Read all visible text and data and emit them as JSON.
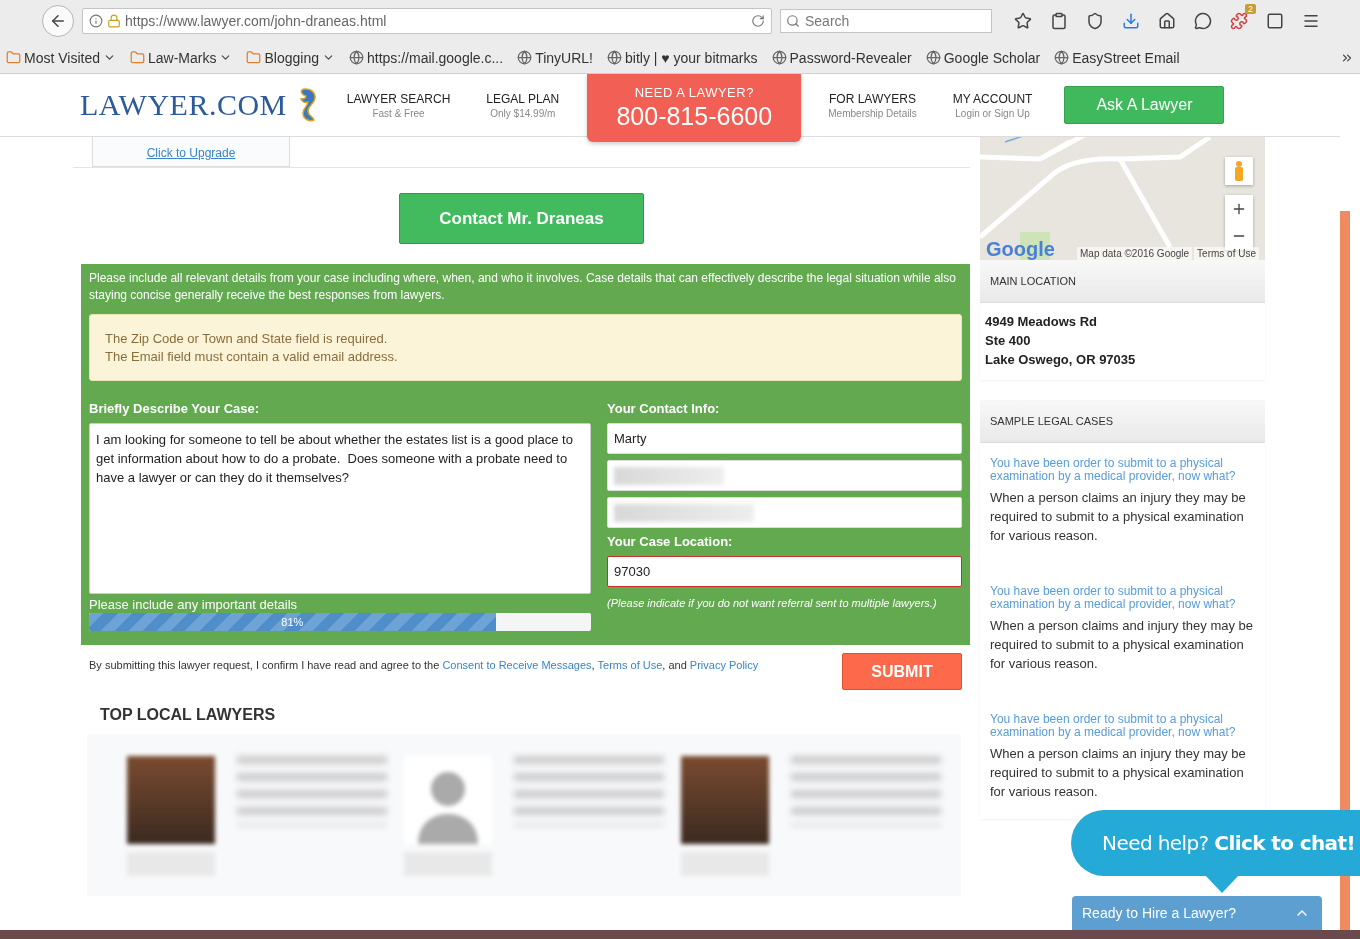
{
  "browser": {
    "url": "https://www.lawyer.com/john-draneas.html",
    "search_placeholder": "Search",
    "extension_badge": "2"
  },
  "bookmarks": [
    {
      "label": "Most Visited",
      "kind": "menu"
    },
    {
      "label": "Law-Marks",
      "kind": "menu"
    },
    {
      "label": "Blogging",
      "kind": "menu"
    },
    {
      "label": "https://mail.google.c...",
      "kind": "site"
    },
    {
      "label": "TinyURL!",
      "kind": "site"
    },
    {
      "label": "bitly | ♥ your bitmarks",
      "kind": "site"
    },
    {
      "label": "Password-Revealer",
      "kind": "site"
    },
    {
      "label": "Google Scholar",
      "kind": "site"
    },
    {
      "label": "EasyStreet Email",
      "kind": "site"
    }
  ],
  "site_header": {
    "logo": "LAWYER.COM",
    "nav": [
      {
        "title": "LAWYER SEARCH",
        "subtitle": "Fast & Free"
      },
      {
        "title": "LEGAL PLAN",
        "subtitle": "Only $14.99/m"
      }
    ],
    "call": {
      "title": "NEED A LAWYER?",
      "phone": "800-815-6600"
    },
    "nav_right": [
      {
        "title": "FOR LAWYERS",
        "subtitle": "Membership Details"
      },
      {
        "title": "MY ACCOUNT",
        "subtitle": "Login or Sign Up"
      }
    ],
    "cta": "Ask A Lawyer"
  },
  "profile": {
    "upgrade_link": "Click to Upgrade"
  },
  "contact_button": "Contact Mr. Draneas",
  "form": {
    "intro": "Please include all relevant details from your case including where, when, and who it involves. Case details that can effectively describe the legal situation while also staying concise generally receive the best responses from lawyers.",
    "errors": [
      "The Zip Code or Town and State field is required.",
      "The Email field must contain a valid email address."
    ],
    "case_label": "Briefly Describe Your Case:",
    "case_value": "I am looking for someone to tell be about whether the estates list is a good place to get information about how to do a probate.  Does someone with a probate need to have a lawyer or can they do it themselves?",
    "hint": "Please include any important details",
    "progress": {
      "level": 0.81,
      "label": "81%"
    },
    "contact_label": "Your Contact Info:",
    "contact_fields": [
      {
        "value": "Marty",
        "blurred": false
      },
      {
        "blurred": true
      },
      {
        "blurred": true
      }
    ],
    "location_label": "Your Case Location:",
    "location": {
      "value": "97030",
      "invalid": true
    },
    "location_note": "(Please indicate if you do not want referral sent to multiple lawyers.)"
  },
  "consent": [
    {
      "kind": "text",
      "text": "By submitting this lawyer request, I confirm I have read and agree to the "
    },
    {
      "kind": "link",
      "text": "Consent to Receive Messages"
    },
    {
      "kind": "text",
      "text": ", "
    },
    {
      "kind": "link",
      "text": "Terms of Use"
    },
    {
      "kind": "text",
      "text": ", and "
    },
    {
      "kind": "link",
      "text": "Privacy Policy"
    }
  ],
  "submit": "SUBMIT",
  "top_lawyers": {
    "title": "TOP LOCAL LAWYERS",
    "lawyers": [
      {
        "kind": "photo"
      },
      {
        "kind": "silhouette"
      },
      {
        "kind": "photo"
      }
    ]
  },
  "map": {
    "logo": "Google",
    "attribution": "Map data ©2016 Google",
    "terms": "Terms of Use"
  },
  "main_location": {
    "title": "MAIN LOCATION",
    "lines": [
      "4949 Meadows Rd",
      "Ste 400",
      "Lake Oswego, OR 97035"
    ]
  },
  "sample_cases": {
    "title": "SAMPLE LEGAL CASES",
    "cases": [
      {
        "title": "You have been order to submit to a physical examination by a medical provider, now what?",
        "body": "When a person claims an injury they may be required to submit to a physical examination for various reason."
      },
      {
        "title": "You have been order to submit to a physical examination by a medical provider, now what?",
        "body": "When a person claims and injury they may be required to submit to a physical examination for various reason."
      },
      {
        "title": "You have been order to submit to a physical examination by a medical provider, now what?",
        "body": "When a person claims an injury they may be required to submit to a physical examination for various reason."
      }
    ]
  },
  "chat": {
    "prompt": "Need help? **Click to chat!**"
  },
  "hire_bar": {
    "label": "Ready to Hire a Lawyer?"
  }
}
